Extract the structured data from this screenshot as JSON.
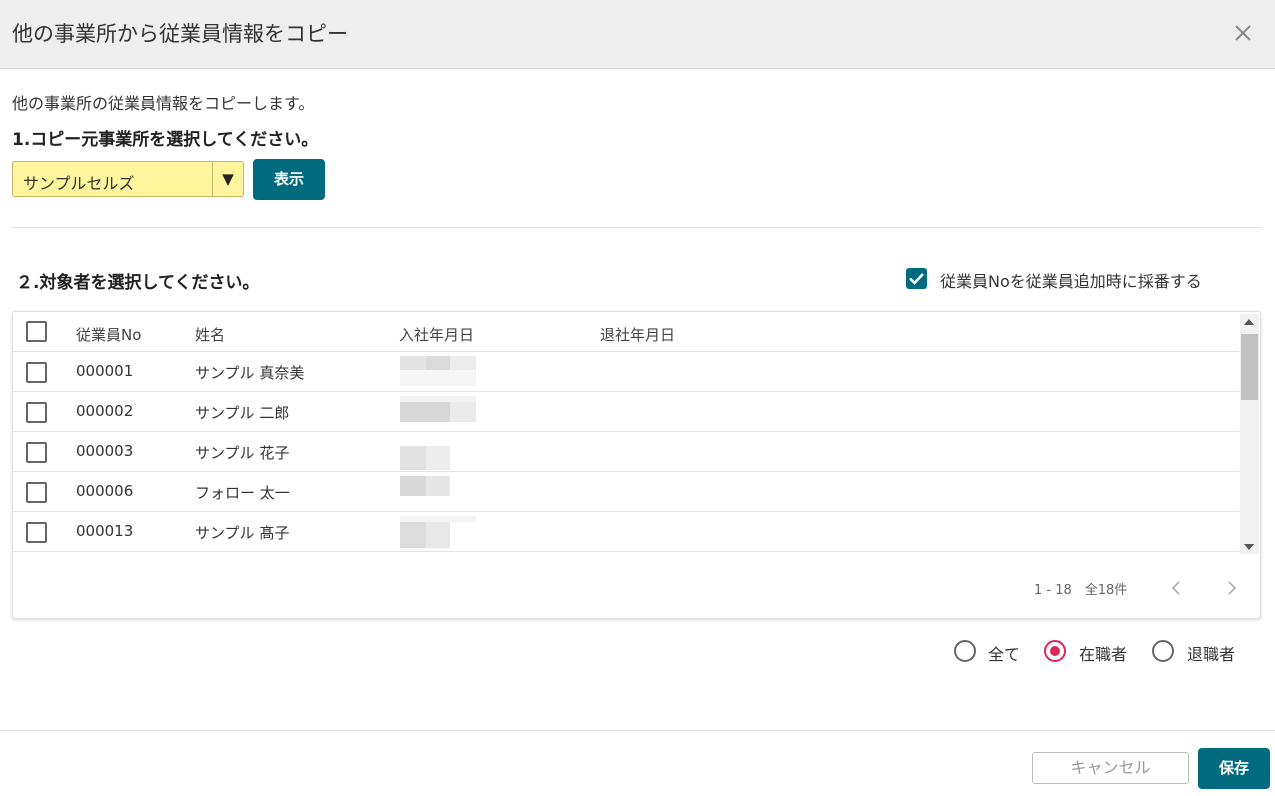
{
  "dialog": {
    "title": "他の事業所から従業員情報をコピー",
    "close_icon": "close-icon"
  },
  "intro_text": "他の事業所の従業員情報をコピーします。",
  "step1": {
    "label": "1.コピー元事業所を選択してください。",
    "office_select_value": "サンプルセルズ",
    "dropdown_arrow": "▼",
    "show_button": "表示"
  },
  "step2": {
    "label": "２.対象者を選択してください。",
    "auto_number_label": "従業員Noを従業員追加時に採番する",
    "auto_number_checked": true
  },
  "table": {
    "columns": [
      "従業員No",
      "姓名",
      "入社年月日",
      "退社年月日"
    ],
    "rows": [
      {
        "no": "000001",
        "name": "サンプル 真奈美",
        "checked": false
      },
      {
        "no": "000002",
        "name": "サンプル 二郎",
        "checked": false
      },
      {
        "no": "000003",
        "name": "サンプル 花子",
        "checked": false
      },
      {
        "no": "000006",
        "name": "フォロー 太一",
        "checked": false
      },
      {
        "no": "000013",
        "name": "サンプル 髙子",
        "checked": false
      }
    ],
    "pagination_text": "1 - 18　全18件"
  },
  "filter": {
    "options": [
      "全て",
      "在職者",
      "退職者"
    ],
    "selected": "在職者"
  },
  "footer": {
    "cancel_label": "キャンセル",
    "save_label": "保存"
  },
  "colors": {
    "primary": "#006b7f",
    "select_bg": "#fff59d",
    "radio_active": "#e0245e"
  }
}
